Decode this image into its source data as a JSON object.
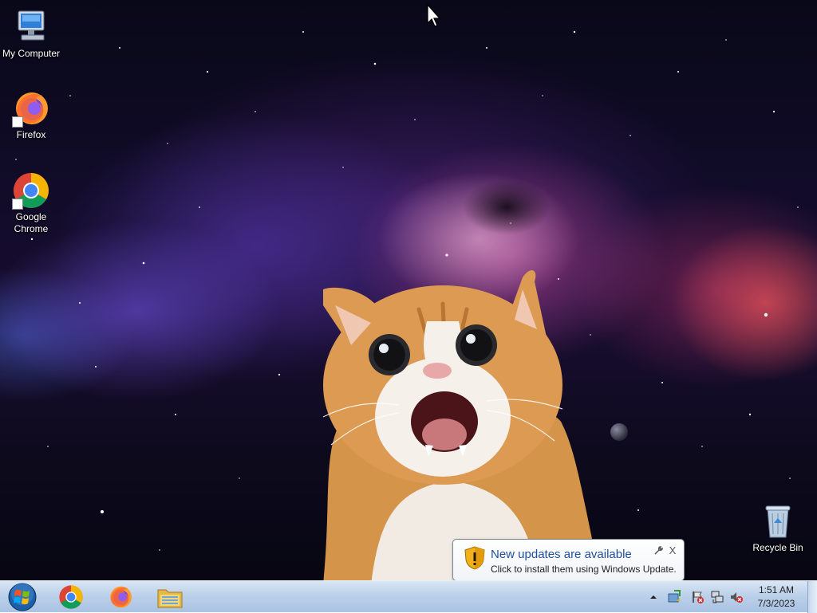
{
  "desktop": {
    "icons": [
      {
        "label": "My Computer"
      },
      {
        "label": "Firefox"
      },
      {
        "label": "Google Chrome"
      },
      {
        "label": "Recycle Bin"
      }
    ]
  },
  "notification": {
    "title": "New updates are available",
    "body": "Click to install them using Windows Update.",
    "close_glyph": "X"
  },
  "taskbar": {
    "pinned": [
      "chrome-icon",
      "firefox-icon",
      "file-explorer-icon"
    ],
    "tray_icons": [
      "show-hidden-icons-chevron",
      "windows-update-icon",
      "action-center-icon",
      "network-icon",
      "volume-muted-icon"
    ],
    "clock": {
      "time": "1:51 AM",
      "date": "7/3/2023"
    }
  },
  "colors": {
    "taskbar_top": "#d9e6f4",
    "taskbar_bottom": "#a9c3e2",
    "balloon_title": "#1f4e9e"
  }
}
